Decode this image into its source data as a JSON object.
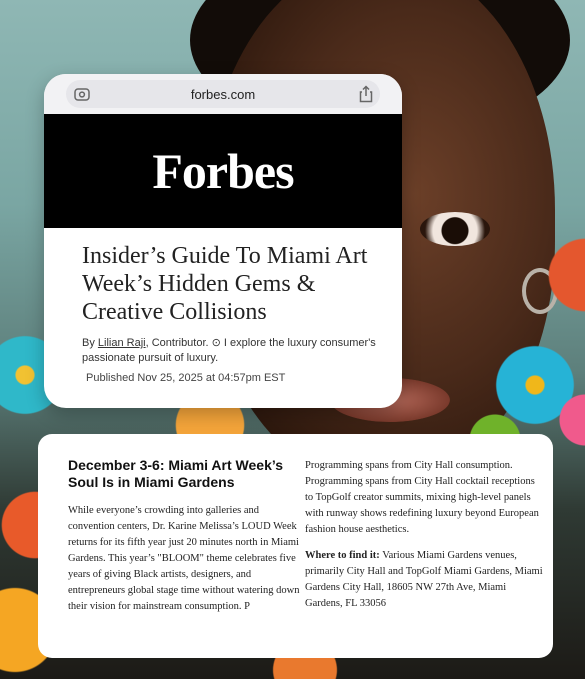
{
  "browser": {
    "url": "forbes.com",
    "left_icon": "camera-scan-icon",
    "right_icon": "share-icon"
  },
  "masthead": {
    "logo": "Forbes"
  },
  "article": {
    "headline": "Insider’s Guide To Miami Art Week’s Hidden Gems & Creative Collisions",
    "byline_prefix": "By",
    "author": "Lilian Raji",
    "byline_rest": ", Contributor. ⊙ I explore the luxury consumer's passionate pursuit of luxury.",
    "published": "Published Nov 25, 2025 at 04:57pm EST"
  },
  "section": {
    "title": "December 3-6: Miami Art Week’s Soul Is in Miami Gardens",
    "body_left": "While everyone’s crowding into galleries and convention centers, Dr. Karine Melissa’s LOUD Week returns for its fifth year just 20 minutes north in Miami Gardens. This year’s \"BLOOM\" theme celebrates five years of giving Black artists, designers, and entrepreneurs global stage time without watering down their vision for mainstream consumption. P",
    "body_right": "Programming spans from City Hall consumption. Programming spans from City Hall cocktail receptions to TopGolf creator summits, mixing high-level panels with runway shows redefining luxury beyond European fashion house aesthetics.",
    "where_label": "Where to find it:",
    "where_text": " Various Miami Gardens venues, primarily City Hall and TopGolf Miami Gardens, Miami Gardens City Hall, 18605 NW 27th Ave, Miami Gardens, FL 33056"
  },
  "colors": {
    "masthead_bg": "#000000",
    "card_bg": "#ffffff",
    "urlbar_bg": "#f2f2f4"
  }
}
